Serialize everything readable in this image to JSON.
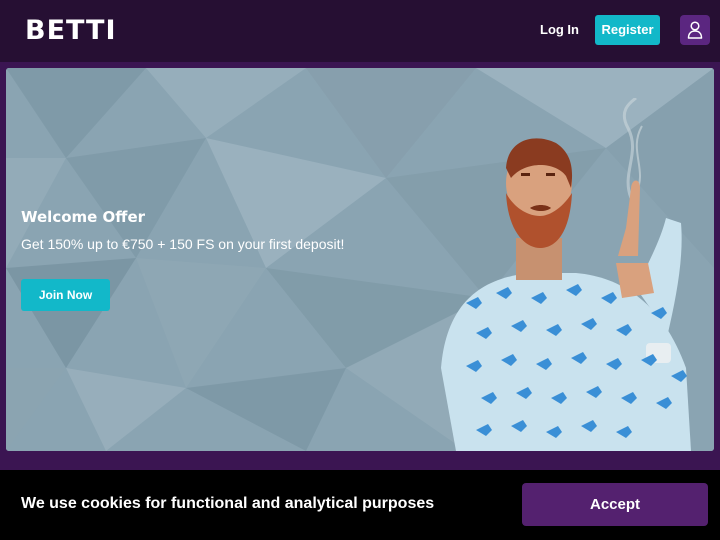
{
  "header": {
    "logo": "BETTI",
    "login_label": "Log In",
    "register_label": "Register",
    "account_icon": "user-icon"
  },
  "banner": {
    "title": "Welcome Offer",
    "subtitle": "Get 150% up to €750 + 150 FS on your first deposit!",
    "cta_label": "Join Now"
  },
  "cookie_banner": {
    "message": "We use cookies for functional and analytical purposes",
    "accept_label": "Accept"
  },
  "colors": {
    "header_bg": "#260f33",
    "page_bg": "#3b1552",
    "accent_teal": "#12b8c9",
    "accent_purple": "#54216f",
    "cookie_bg": "#000000"
  }
}
